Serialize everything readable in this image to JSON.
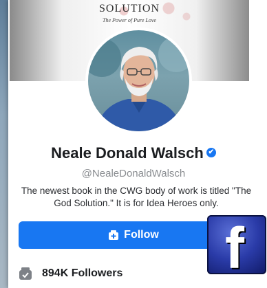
{
  "cover": {
    "title": "SOLUTION",
    "subtitle": "The Power of Pure Love"
  },
  "profile": {
    "name": "Neale Donald Walsch",
    "verified_glyph": "✔",
    "handle": "@NealeDonaldWalsch",
    "bio": "The newest book in the CWG body of work is titled \"The God Solution.\" It is for Idea Heroes only."
  },
  "actions": {
    "follow_label": "Follow"
  },
  "stats": {
    "followers_label": "894K Followers"
  },
  "logo": {
    "letter": "f"
  },
  "icons": {
    "verified": "verified-badge-icon",
    "follow": "follow-icon",
    "followers": "followers-icon"
  },
  "colors": {
    "brand": "#1877f2",
    "text": "#1c1e21",
    "muted": "#8a8d91"
  }
}
